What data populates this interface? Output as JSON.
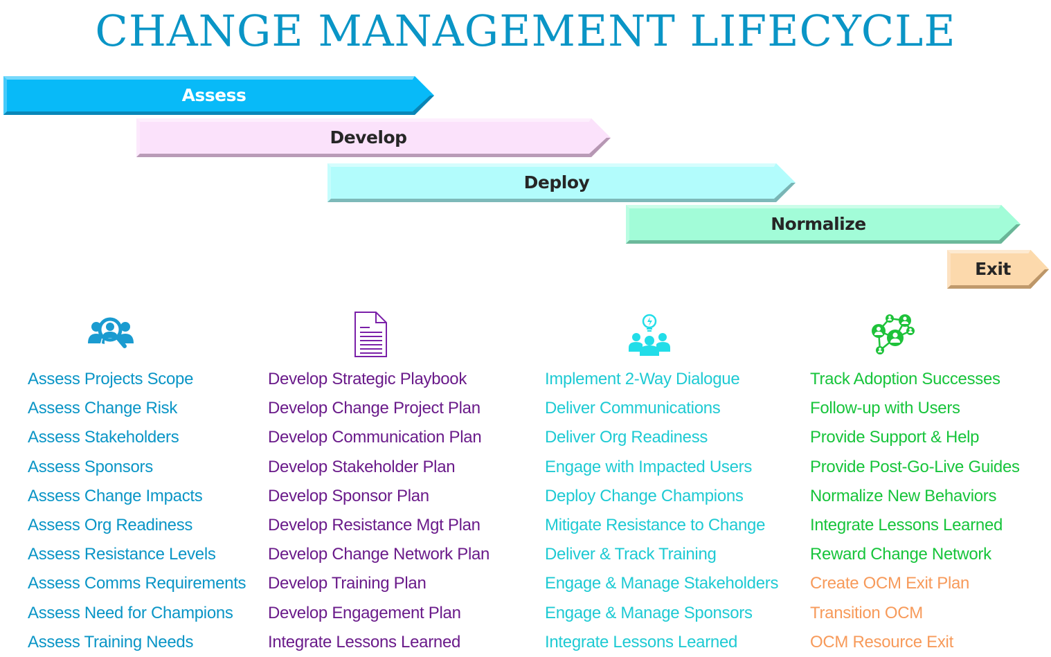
{
  "title": "Change Management Lifecycle",
  "colors": {
    "title": "#0a95c6",
    "assess": "#0a95c6",
    "develop": "#6a1b8a",
    "deploy": "#1ecad3",
    "normalize": "#17c43b",
    "exit": "#f79a5a"
  },
  "phases": [
    {
      "label": "Assess",
      "fill": "#08baf8",
      "dark": "#0a7aa8",
      "text": "light"
    },
    {
      "label": "Develop",
      "fill": "#fbe2fb",
      "dark": "#a98aa6",
      "text": "dark"
    },
    {
      "label": "Deploy",
      "fill": "#b2fcfc",
      "dark": "#6fa8a8",
      "text": "dark"
    },
    {
      "label": "Normalize",
      "fill": "#a2fcd8",
      "dark": "#5fa88c",
      "text": "dark"
    },
    {
      "label": "Exit",
      "fill": "#fcd9ac",
      "dark": "#b08a5c",
      "text": "dark"
    }
  ],
  "icons": [
    {
      "name": "people-search-icon",
      "color": "#1a9bd0"
    },
    {
      "name": "document-icon",
      "color": "#7a1fa8"
    },
    {
      "name": "team-idea-icon",
      "color": "#22dde8"
    },
    {
      "name": "network-icon",
      "color": "#1ec23a"
    }
  ],
  "columns": [
    {
      "id": "assess",
      "items": [
        {
          "text": "Assess Projects Scope",
          "tone": "assess"
        },
        {
          "text": "Assess Change Risk",
          "tone": "assess"
        },
        {
          "text": "Assess Stakeholders",
          "tone": "assess"
        },
        {
          "text": "Assess Sponsors",
          "tone": "assess"
        },
        {
          "text": "Assess Change Impacts",
          "tone": "assess"
        },
        {
          "text": "Assess Org Readiness",
          "tone": "assess"
        },
        {
          "text": "Assess Resistance Levels",
          "tone": "assess"
        },
        {
          "text": "Assess Comms Requirements",
          "tone": "assess"
        },
        {
          "text": "Assess Need for Champions",
          "tone": "assess"
        },
        {
          "text": "Assess Training Needs",
          "tone": "assess"
        }
      ]
    },
    {
      "id": "develop",
      "items": [
        {
          "text": "Develop Strategic Playbook",
          "tone": "develop"
        },
        {
          "text": "Develop Change Project Plan",
          "tone": "develop"
        },
        {
          "text": "Develop Communication Plan",
          "tone": "develop"
        },
        {
          "text": "Develop Stakeholder Plan",
          "tone": "develop"
        },
        {
          "text": "Develop Sponsor Plan",
          "tone": "develop"
        },
        {
          "text": "Develop Resistance Mgt Plan",
          "tone": "develop"
        },
        {
          "text": "Develop Change Network Plan",
          "tone": "develop"
        },
        {
          "text": "Develop Training Plan",
          "tone": "develop"
        },
        {
          "text": "Develop Engagement Plan",
          "tone": "develop"
        },
        {
          "text": "Integrate Lessons Learned",
          "tone": "develop"
        }
      ]
    },
    {
      "id": "deploy",
      "items": [
        {
          "text": "Implement 2-Way Dialogue",
          "tone": "deploy"
        },
        {
          "text": "Deliver Communications",
          "tone": "deploy"
        },
        {
          "text": "Deliver Org Readiness",
          "tone": "deploy"
        },
        {
          "text": "Engage with Impacted Users",
          "tone": "deploy"
        },
        {
          "text": "Deploy Change Champions",
          "tone": "deploy"
        },
        {
          "text": "Mitigate Resistance to Change",
          "tone": "deploy"
        },
        {
          "text": "Deliver & Track Training",
          "tone": "deploy"
        },
        {
          "text": "Engage & Manage Stakeholders",
          "tone": "deploy"
        },
        {
          "text": "Engage & Manage Sponsors",
          "tone": "deploy"
        },
        {
          "text": "Integrate Lessons Learned",
          "tone": "deploy"
        }
      ]
    },
    {
      "id": "normalize",
      "items": [
        {
          "text": "Track Adoption Successes",
          "tone": "normalize"
        },
        {
          "text": "Follow-up with Users",
          "tone": "normalize"
        },
        {
          "text": "Provide Support & Help",
          "tone": "normalize"
        },
        {
          "text": "Provide Post-Go-Live Guides",
          "tone": "normalize"
        },
        {
          "text": "Normalize New Behaviors",
          "tone": "normalize"
        },
        {
          "text": "Integrate Lessons Learned",
          "tone": "normalize"
        },
        {
          "text": "Reward Change Network",
          "tone": "normalize"
        },
        {
          "text": "Create OCM Exit Plan",
          "tone": "exit"
        },
        {
          "text": "Transition OCM",
          "tone": "exit"
        },
        {
          "text": "OCM Resource Exit",
          "tone": "exit"
        }
      ]
    }
  ]
}
